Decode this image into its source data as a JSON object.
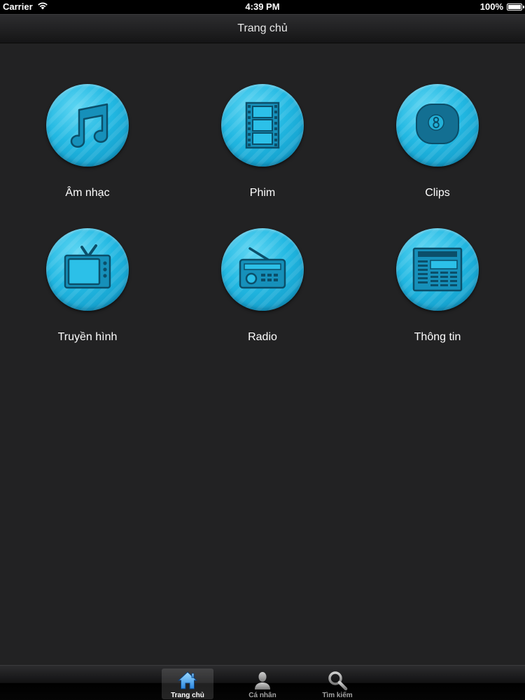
{
  "status_bar": {
    "carrier": "Carrier",
    "time": "4:39 PM",
    "battery": "100%",
    "battery_level": 1.0
  },
  "nav": {
    "title": "Trang chủ"
  },
  "colors": {
    "accent": "#22b8e2",
    "background": "#222223",
    "icon_glyph": "#0e5f7d"
  },
  "menu": {
    "items": [
      {
        "label": "Âm nhạc",
        "icon": "music-note-icon"
      },
      {
        "label": "Phim",
        "icon": "film-strip-icon"
      },
      {
        "label": "Clips",
        "icon": "eight-ball-icon"
      },
      {
        "label": "Truyền hình",
        "icon": "television-icon"
      },
      {
        "label": "Radio",
        "icon": "radio-icon"
      },
      {
        "label": "Thông tin",
        "icon": "newspaper-icon"
      }
    ]
  },
  "tab_bar": {
    "tabs": [
      {
        "label": "Trang chủ",
        "icon": "home-icon",
        "active": true
      },
      {
        "label": "Cá nhân",
        "icon": "person-icon",
        "active": false
      },
      {
        "label": "Tìm kiếm",
        "icon": "search-icon",
        "active": false
      }
    ]
  }
}
